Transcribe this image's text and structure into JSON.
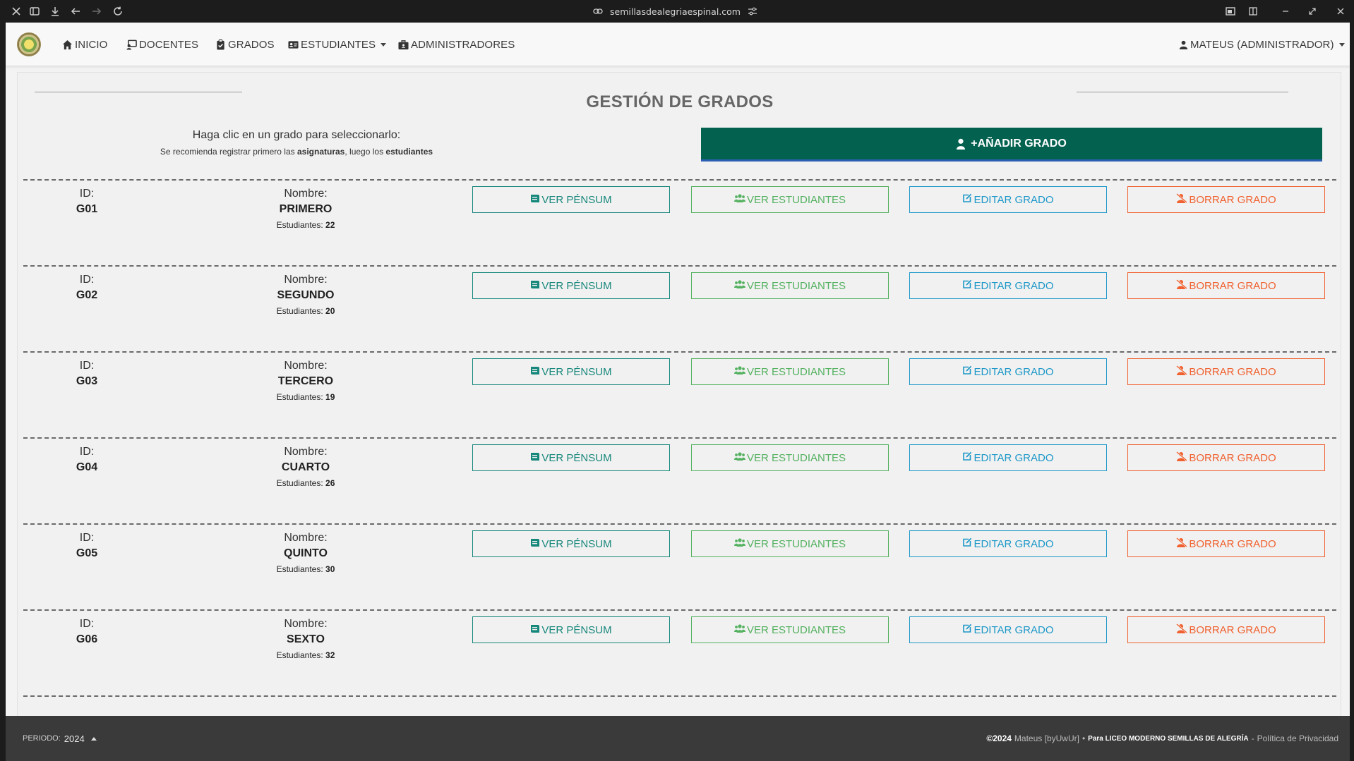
{
  "browser": {
    "url": "semillasdealegriaespinal.com"
  },
  "nav": {
    "items": [
      {
        "label": "INICIO",
        "icon": "home-icon"
      },
      {
        "label": "DOCENTES",
        "icon": "teacher-icon"
      },
      {
        "label": "GRADOS",
        "icon": "clipboard-icon"
      },
      {
        "label": "ESTUDIANTES",
        "icon": "id-card-icon",
        "dropdown": true
      },
      {
        "label": "ADMINISTRADORES",
        "icon": "briefcase-icon"
      }
    ],
    "user": "MATEUS (ADMINISTRADOR)"
  },
  "page": {
    "title": "GESTIÓN DE GRADOS",
    "hint_main": "Haga clic en un grado para seleccionarlo:",
    "hint_sub_1": "Se recomienda registrar primero las",
    "hint_sub_bold_1": "asignaturas",
    "hint_sub_2": ", luego los",
    "hint_sub_bold_2": "estudiantes",
    "add_button": "+AÑADIR GRADO"
  },
  "labels": {
    "id": "ID:",
    "name": "Nombre:",
    "students": "Estudiantes:",
    "btn_pensum": "VER PÉNSUM",
    "btn_students": "VER ESTUDIANTES",
    "btn_edit": "EDITAR GRADO",
    "btn_delete": "BORRAR GRADO"
  },
  "grades": [
    {
      "id": "G01",
      "name": "PRIMERO",
      "students": "22"
    },
    {
      "id": "G02",
      "name": "SEGUNDO",
      "students": "20"
    },
    {
      "id": "G03",
      "name": "TERCERO",
      "students": "19"
    },
    {
      "id": "G04",
      "name": "CUARTO",
      "students": "26"
    },
    {
      "id": "G05",
      "name": "QUINTO",
      "students": "30"
    },
    {
      "id": "G06",
      "name": "SEXTO",
      "students": "32"
    }
  ],
  "footer": {
    "period_label": "PERIODO:",
    "period_value": "2024",
    "copyright": "©2024",
    "author": "Mateus [byUwUr]",
    "sep": "•",
    "for_text": "Para LICEO MODERNO SEMILLAS DE ALEGRÍA",
    "dash": "-",
    "privacy": "Política de Privacidad"
  },
  "colors": {
    "primary_teal": "#03614f",
    "pensum": "#16877b",
    "students": "#53b15f",
    "edit": "#1d98c8",
    "delete": "#f0612f"
  }
}
